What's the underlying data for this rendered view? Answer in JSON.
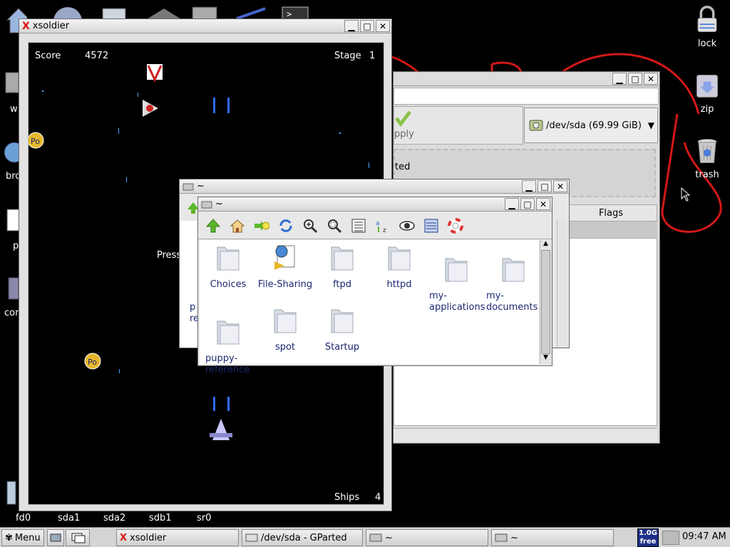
{
  "desktop": {
    "icons_right": [
      {
        "label": "lock",
        "icon": "lock-icon"
      },
      {
        "label": "zip",
        "icon": "zip-icon"
      },
      {
        "label": "trash",
        "icon": "trash-icon"
      }
    ],
    "icons_left_partial": [
      "w",
      "bro",
      "p",
      "con"
    ],
    "drives": [
      "fd0",
      "sda1",
      "sda2",
      "sdb1",
      "sr0"
    ]
  },
  "xsoldier": {
    "title": "xsoldier",
    "score_label": "Score",
    "score_value": "4572",
    "stage_label": "Stage",
    "stage_value": "1",
    "ships_label": "Ships",
    "ships_value": "4",
    "press_text": "Press"
  },
  "gparted": {
    "apply_label": "pply",
    "device": "/dev/sda  (69.99 GiB)",
    "status_text": "ted",
    "flags_header": "Flags"
  },
  "fm_back": {
    "title": "~",
    "partial_labels": [
      "p",
      "re"
    ]
  },
  "fm_front": {
    "title": "~",
    "toolbar": [
      "up-arrow-icon",
      "home-icon",
      "bookmark-icon",
      "refresh-icon",
      "zoom-in-icon",
      "zoom-fit-icon",
      "list-view-icon",
      "sort-az-icon",
      "eye-icon",
      "details-view-icon",
      "help-lifebuoy-icon"
    ],
    "items": [
      {
        "label": "Choices"
      },
      {
        "label": "File-Sharing"
      },
      {
        "label": "ftpd"
      },
      {
        "label": "httpd"
      },
      {
        "label": "my-\napplications"
      },
      {
        "label": "my-\ndocuments"
      },
      {
        "label": "puppy-\nreference"
      },
      {
        "label": "spot"
      },
      {
        "label": "Startup"
      }
    ]
  },
  "taskbar": {
    "menu_label": "Menu",
    "tasks": [
      "xsoldier",
      "/dev/sda - GParted",
      "~",
      "~"
    ],
    "free_top": "1.0G",
    "free_bottom": "free",
    "clock": "09:47 AM"
  },
  "colors": {
    "desktop_bg": "#000000",
    "scribble": "#d31818",
    "file_label": "#1b2870"
  }
}
